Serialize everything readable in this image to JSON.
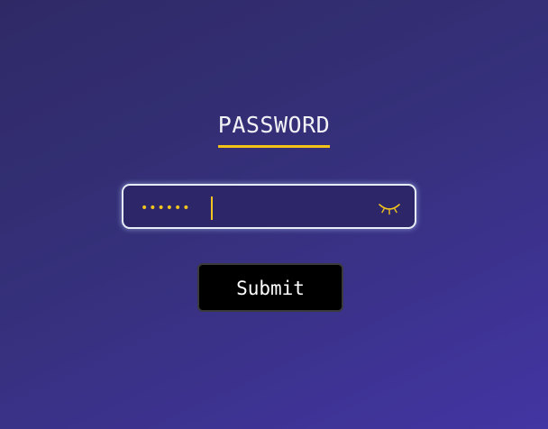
{
  "page": {
    "title": "PASSWORD"
  },
  "password_field": {
    "masked_value": "••••••",
    "toggle_icon": "eye-closed-icon"
  },
  "submit_button": {
    "label": "Submit"
  },
  "colors": {
    "accent": "#f2c316",
    "background_start": "#2f2a66",
    "background_end": "#4335a3",
    "button_bg": "#000000",
    "field_border": "#e7edf7"
  }
}
